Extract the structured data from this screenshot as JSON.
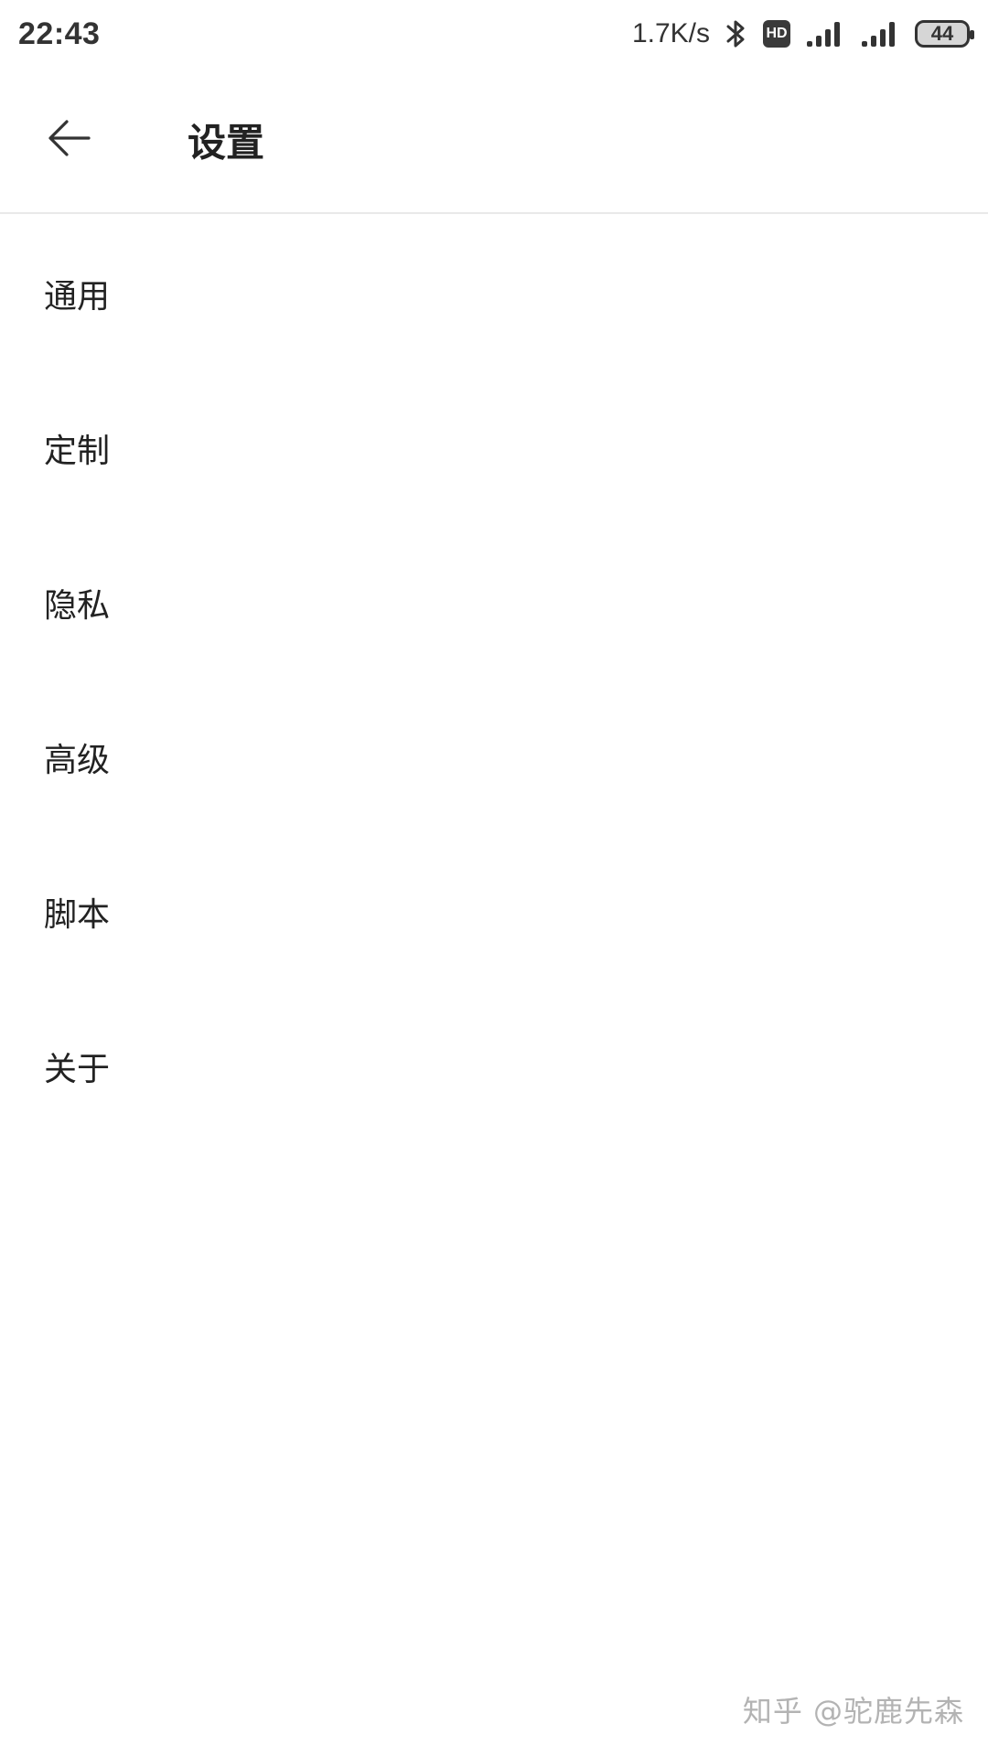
{
  "status_bar": {
    "time": "22:43",
    "net_speed": "1.7K/s",
    "bluetooth_icon": "bluetooth-icon",
    "hd_badge": "HD",
    "signal_icon_1": "signal-icon",
    "signal_icon_2": "signal-icon",
    "battery_level": "44"
  },
  "app_bar": {
    "back_icon": "arrow-left-icon",
    "title": "设置"
  },
  "settings": {
    "items": [
      {
        "label": "通用"
      },
      {
        "label": "定制"
      },
      {
        "label": "隐私"
      },
      {
        "label": "高级"
      },
      {
        "label": "脚本"
      },
      {
        "label": "关于"
      }
    ]
  },
  "watermark": {
    "text": "知乎 @驼鹿先森"
  },
  "colors": {
    "background": "#ffffff",
    "text": "#222222",
    "divider": "#e9e9e9",
    "status": "#333333"
  }
}
